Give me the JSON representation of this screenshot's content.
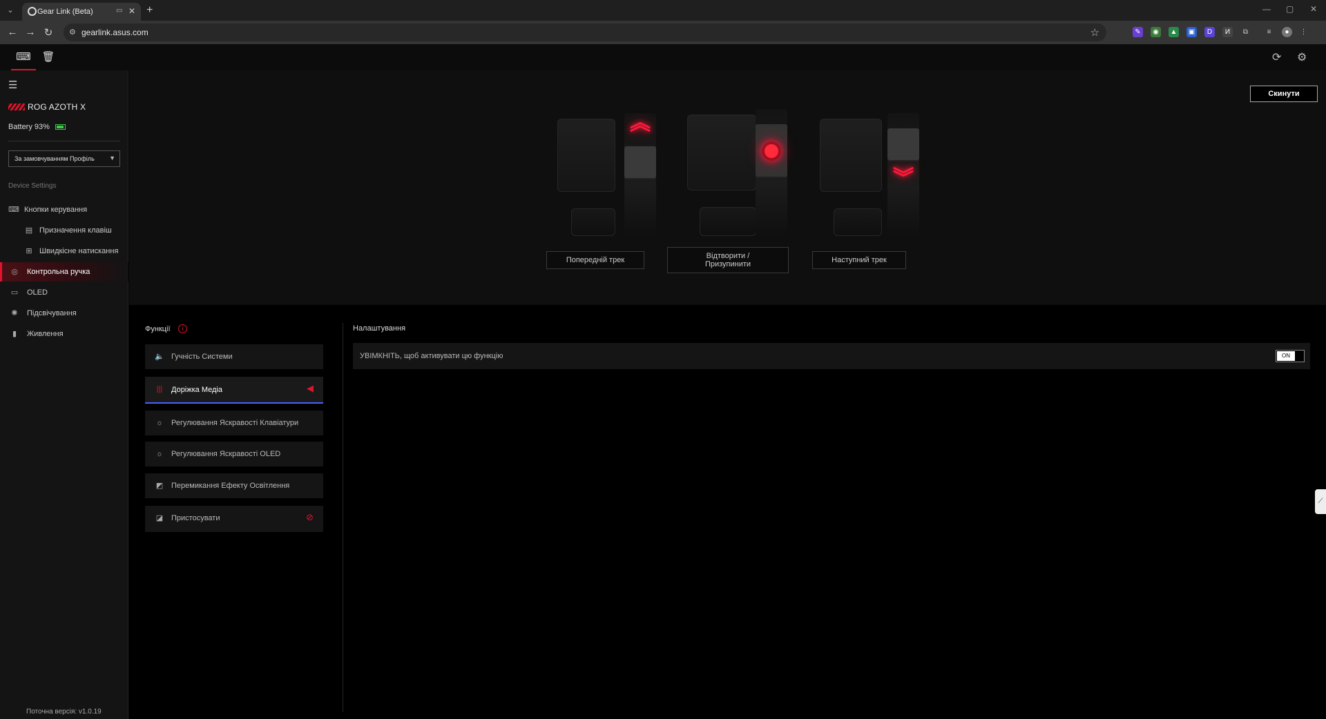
{
  "browser": {
    "tab_title": "Gear Link (Beta)",
    "url": "gearlink.asus.com"
  },
  "sidebar": {
    "device_name": "ROG AZOTH X",
    "battery": "Battery 93%",
    "battery_level": 0.93,
    "profile": "За замовчуванням Профіль",
    "section": "Device Settings",
    "items": [
      {
        "label": "Кнопки керування",
        "icon": "keyboard-icon"
      },
      {
        "label": "Призначення клавіш",
        "icon": "keymap-icon"
      },
      {
        "label": "Швидкісне натискання",
        "icon": "rapid-trigger-icon"
      },
      {
        "label": "Контрольна ручка",
        "icon": "knob-icon"
      },
      {
        "label": "OLED",
        "icon": "oled-icon"
      },
      {
        "label": "Підсвічування",
        "icon": "lighting-icon"
      },
      {
        "label": "Живлення",
        "icon": "battery-icon"
      }
    ],
    "version": "Поточна версія: v1.0.19"
  },
  "main": {
    "reset_label": "Скинути",
    "actions": {
      "prev": "Попередній трек",
      "play_pause": "Відтворити / Призупинити",
      "next": "Наступний трек"
    },
    "functions_title": "Функції",
    "functions": [
      {
        "label": "Гучність Системи",
        "icon": "volume-icon"
      },
      {
        "label": "Доріжка Медіа",
        "icon": "media-track-icon"
      },
      {
        "label": "Регулювання Яскравості Клавіатури",
        "icon": "brightness-icon"
      },
      {
        "label": "Регулювання Яскравості OLED",
        "icon": "brightness-icon"
      },
      {
        "label": "Перемикання Ефекту Освітлення",
        "icon": "lighting-effect-icon"
      },
      {
        "label": "Пристосувати",
        "icon": "customize-icon"
      }
    ],
    "settings_title": "Налаштування",
    "setting_label": "УВІМКНІТЬ, щоб активувати цю функцію",
    "toggle_state": "ON"
  },
  "colors": {
    "accent": "#e2132b",
    "active_underline": "#4a60ff",
    "battery": "#3dcc4a"
  }
}
